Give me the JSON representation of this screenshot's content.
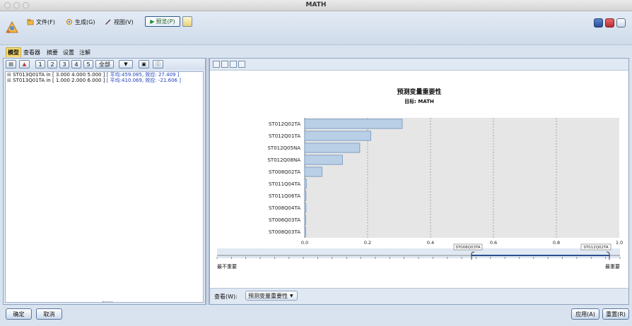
{
  "window": {
    "title": "MATH"
  },
  "menu": {
    "file": "文件(F)",
    "generate": "生成(G)",
    "view": "视图(V)",
    "preview": "预览(P)"
  },
  "tabs": [
    "模型",
    "查看器",
    "摘要",
    "设置",
    "注解"
  ],
  "left_toolbar": {
    "levels": [
      "1",
      "2",
      "3",
      "4",
      "5"
    ],
    "all": "全部"
  },
  "rules": [
    {
      "prefix": "ST013Q01TA in [ 3.000 4.000 5.000 ]",
      "stats": "[ 平均:459.085, 效应: 27.409 ]"
    },
    {
      "prefix": "ST013Q01TA in [ 1.000 2.000 6.000 ]",
      "stats": "[ 平均:410.069, 效应: -21.606 ]"
    }
  ],
  "chart_data": {
    "type": "bar",
    "orientation": "horizontal",
    "title": "预测变量重要性",
    "subtitle": "目标:  MATH",
    "categories": [
      "ST012Q02TA",
      "ST012Q01TA",
      "ST012Q05NA",
      "ST012Q08NA",
      "ST008Q02TA",
      "ST011Q04TA",
      "ST011Q06TA",
      "ST008Q04TA",
      "ST006Q03TA",
      "ST008Q03TA"
    ],
    "values": [
      0.31,
      0.21,
      0.175,
      0.12,
      0.055,
      0.005,
      0.004,
      0.004,
      0.003,
      0.003
    ],
    "xlim": [
      0,
      1
    ],
    "xticks": [
      "0.0",
      "0.2",
      "0.4",
      "0.6",
      "0.8",
      "1.0"
    ],
    "grid": "vertical dashed",
    "bar_color": "#b9cfe6",
    "bar_border": "#6f93bd"
  },
  "slider": {
    "left_marker": "ST008Q03TA",
    "right_marker": "ST012Q02TA",
    "low_label": "最不重要",
    "high_label": "最重要"
  },
  "view_selector": {
    "label": "查看(W):",
    "value": "预测变量重要性"
  },
  "footer": {
    "ok": "确定",
    "cancel": "取消",
    "apply": "应用(A)",
    "reset": "重置(R)"
  },
  "colors": {
    "accent": "#f6d96b",
    "panel_bg": "#d9e3ef",
    "plot_bg": "#e6e6e6",
    "selected_range": "#2c4f8c"
  }
}
